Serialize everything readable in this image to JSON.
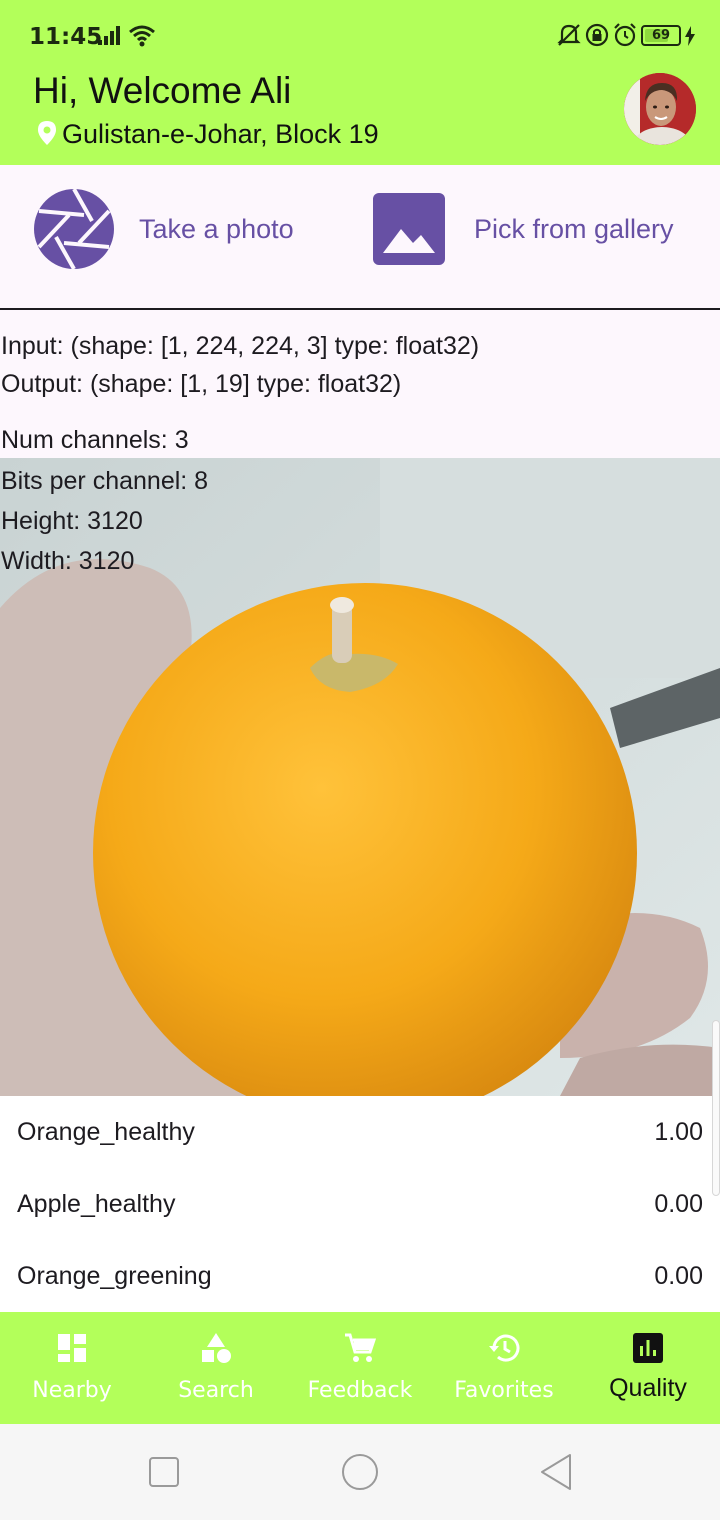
{
  "status_bar": {
    "time": "11:45",
    "battery_level": 69,
    "battery_text": "69",
    "icons": [
      "signal-icon",
      "wifi-icon",
      "bell-off-icon",
      "screen-lock-icon",
      "alarm-icon",
      "battery-icon",
      "charging-icon"
    ]
  },
  "header": {
    "greeting": "Hi, Welcome Ali",
    "location": "Gulistan-e-Johar, Block 19"
  },
  "actions": {
    "take_photo": "Take a photo",
    "pick_gallery": "Pick from gallery"
  },
  "model_info": {
    "input": "Input: (shape: [1, 224, 224, 3] type: float32)",
    "output": "Output: (shape: [1, 19] type: float32)"
  },
  "image_info": {
    "channels": "Num channels: 3",
    "bits": "Bits per channel: 8",
    "height": "Height: 3120",
    "width": "Width: 3120"
  },
  "results": [
    {
      "label": "Orange_healthy",
      "value": "1.00"
    },
    {
      "label": "Apple_healthy",
      "value": "0.00"
    },
    {
      "label": "Orange_greening",
      "value": "0.00"
    }
  ],
  "bottom_nav": {
    "items": [
      {
        "label": "Nearby",
        "icon": "dashboard-icon",
        "active": false
      },
      {
        "label": "Search",
        "icon": "shapes-icon",
        "active": false
      },
      {
        "label": "Feedback",
        "icon": "cart-icon",
        "active": false
      },
      {
        "label": "Favorites",
        "icon": "history-icon",
        "active": false
      },
      {
        "label": "Quality",
        "icon": "chart-icon",
        "active": true
      }
    ]
  },
  "colors": {
    "accent": "#b3ff5a",
    "primary": "#6750a4",
    "text": "#1d1b20"
  }
}
